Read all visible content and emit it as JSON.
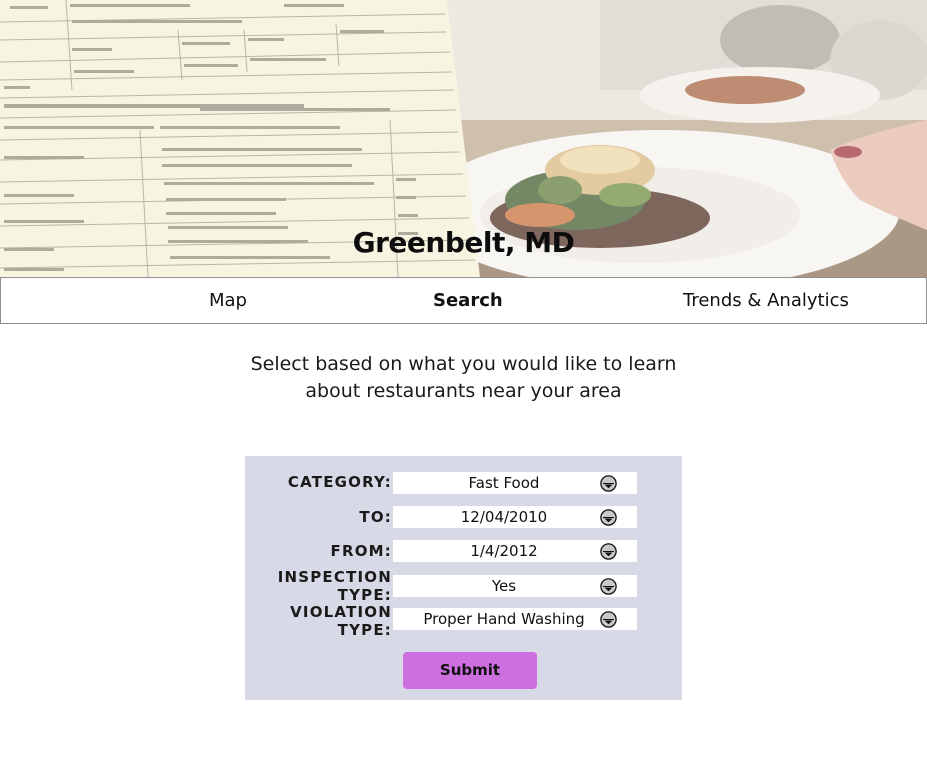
{
  "hero": {
    "title": "Greenbelt, MD"
  },
  "nav": {
    "items": [
      {
        "label": "Map"
      },
      {
        "label": "Search"
      },
      {
        "label": "Trends & Analytics"
      }
    ],
    "active": "Search"
  },
  "intro": {
    "line1": "Select based on what you would like to learn",
    "line2": "about restaurants near your area"
  },
  "form": {
    "category": {
      "label": "CATEGORY:",
      "value": "Fast Food"
    },
    "to": {
      "label": "TO:",
      "value": "12/04/2010"
    },
    "from": {
      "label": "FROM:",
      "value": "1/4/2012"
    },
    "inspection_type": {
      "label_line1": "INSPECTION",
      "label_line2": "TYPE:",
      "value": "Yes"
    },
    "violation_type": {
      "label_line1": "VIOLATION",
      "label_line2": "TYPE:",
      "value": "Proper Hand Washing"
    },
    "submit_label": "Submit"
  },
  "colors": {
    "panel_bg": "#d8d9e6",
    "submit_bg": "#cd6fe0",
    "nav_border": "#8f8f8f"
  }
}
